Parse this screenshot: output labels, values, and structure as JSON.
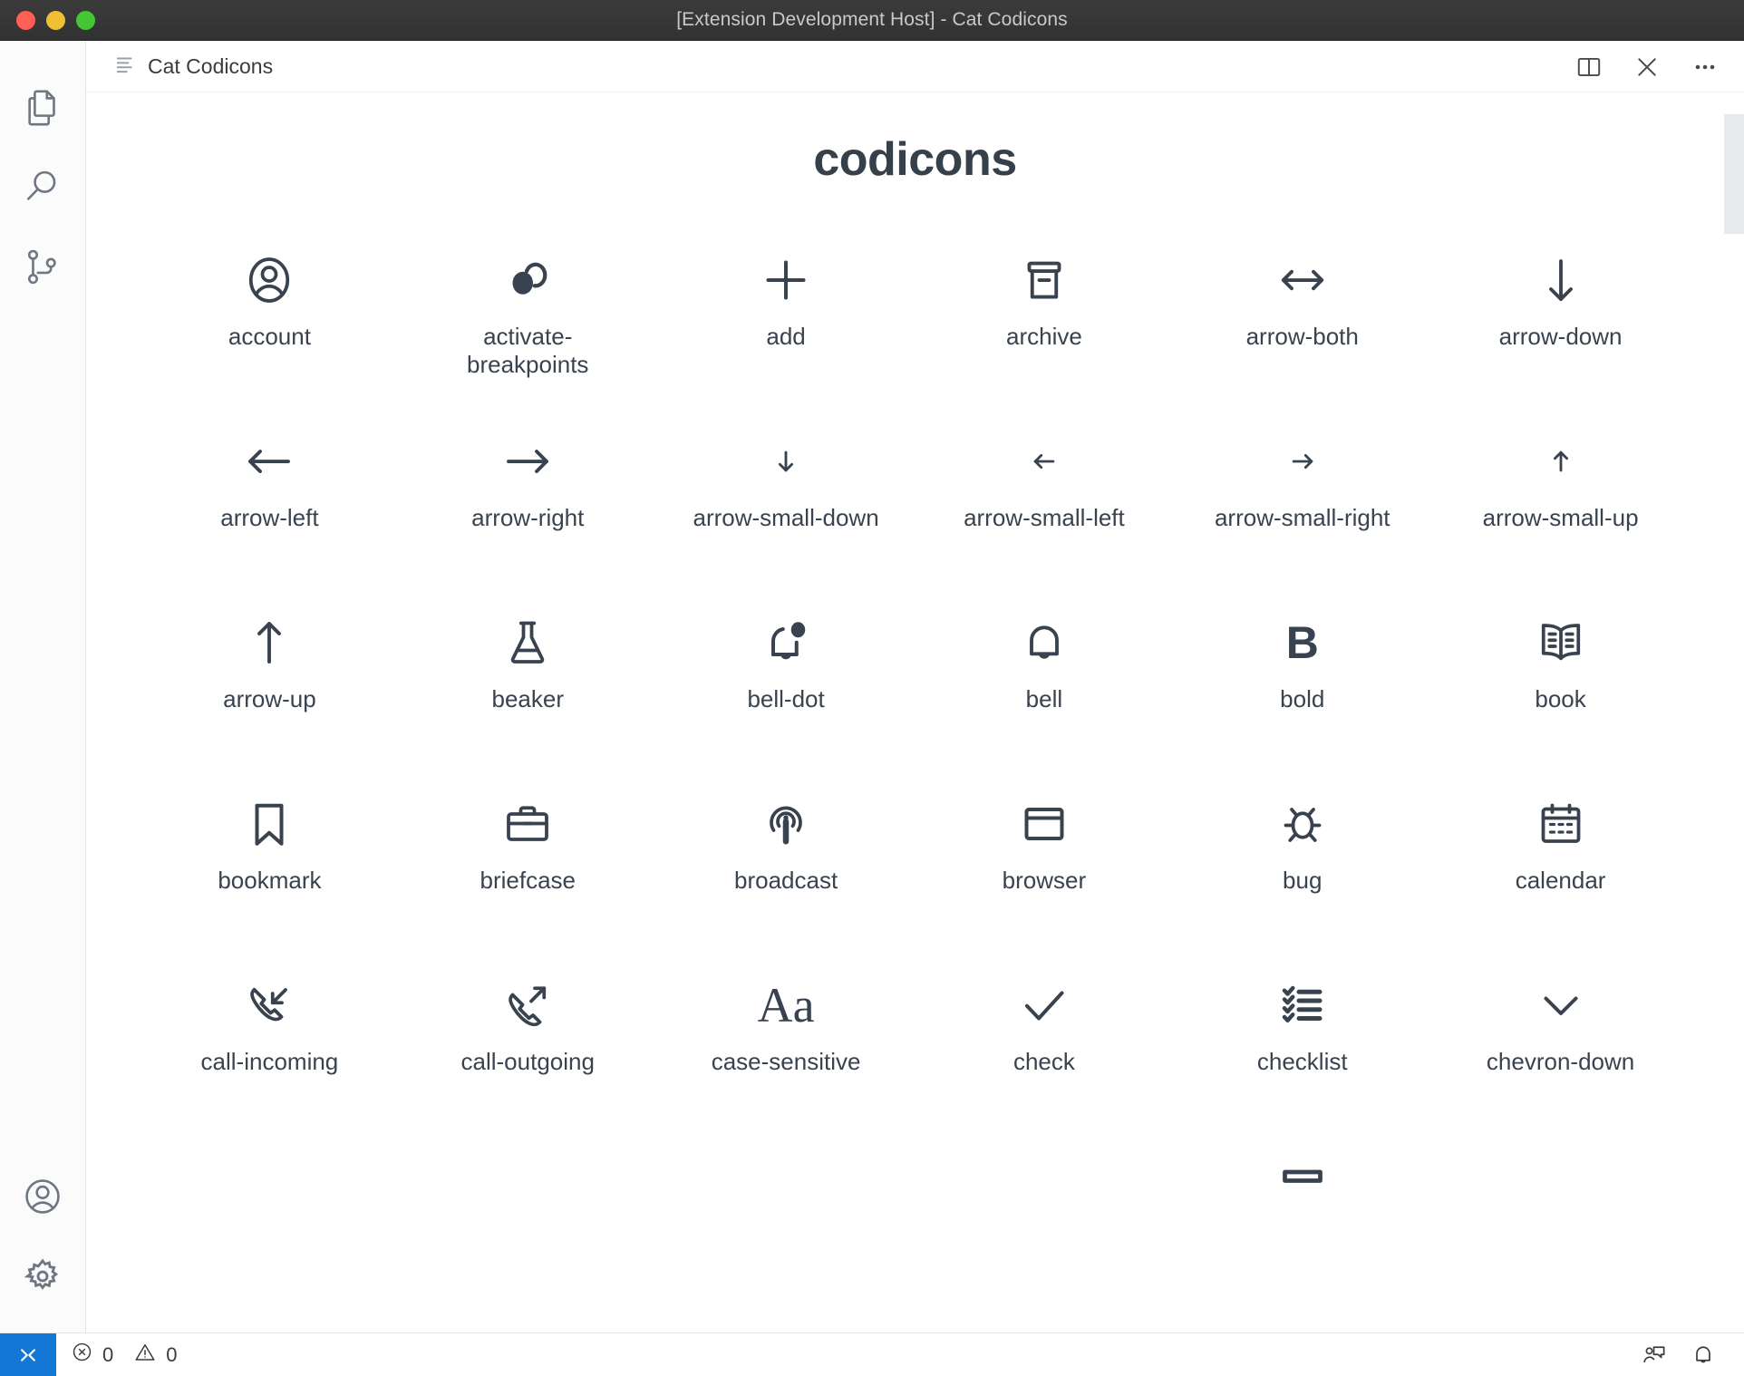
{
  "window": {
    "title": "[Extension Development Host] - Cat Codicons",
    "traffic_lights": [
      {
        "name": "close",
        "color": "#ff5f57"
      },
      {
        "name": "minimize",
        "color": "#f0bf33"
      },
      {
        "name": "zoom",
        "color": "#45c635"
      }
    ]
  },
  "activity_bar": {
    "top_items": [
      {
        "name": "explorer",
        "icon": "files-icon"
      },
      {
        "name": "search",
        "icon": "search-icon"
      },
      {
        "name": "source-control",
        "icon": "source-control-icon"
      }
    ],
    "bottom_items": [
      {
        "name": "accounts",
        "icon": "account-icon"
      },
      {
        "name": "manage",
        "icon": "gear-icon"
      }
    ]
  },
  "tab": {
    "label": "Cat Codicons",
    "icon": "preview-lines-icon",
    "actions": [
      {
        "name": "split-editor",
        "icon": "split-editor-icon"
      },
      {
        "name": "close-editor",
        "icon": "close-icon"
      },
      {
        "name": "more-actions",
        "icon": "ellipsis-icon"
      }
    ]
  },
  "page": {
    "title": "codicons",
    "icons": [
      {
        "label": "account",
        "glyph": "account"
      },
      {
        "label": "activate-breakpoints",
        "glyph": "activate-breakpoints"
      },
      {
        "label": "add",
        "glyph": "add"
      },
      {
        "label": "archive",
        "glyph": "archive"
      },
      {
        "label": "arrow-both",
        "glyph": "arrow-both"
      },
      {
        "label": "arrow-down",
        "glyph": "arrow-down"
      },
      {
        "label": "arrow-left",
        "glyph": "arrow-left"
      },
      {
        "label": "arrow-right",
        "glyph": "arrow-right"
      },
      {
        "label": "arrow-small-down",
        "glyph": "arrow-small-down"
      },
      {
        "label": "arrow-small-left",
        "glyph": "arrow-small-left"
      },
      {
        "label": "arrow-small-right",
        "glyph": "arrow-small-right"
      },
      {
        "label": "arrow-small-up",
        "glyph": "arrow-small-up"
      },
      {
        "label": "arrow-up",
        "glyph": "arrow-up"
      },
      {
        "label": "beaker",
        "glyph": "beaker"
      },
      {
        "label": "bell-dot",
        "glyph": "bell-dot"
      },
      {
        "label": "bell",
        "glyph": "bell"
      },
      {
        "label": "bold",
        "glyph": "bold"
      },
      {
        "label": "book",
        "glyph": "book"
      },
      {
        "label": "bookmark",
        "glyph": "bookmark"
      },
      {
        "label": "briefcase",
        "glyph": "briefcase"
      },
      {
        "label": "broadcast",
        "glyph": "broadcast"
      },
      {
        "label": "browser",
        "glyph": "browser"
      },
      {
        "label": "bug",
        "glyph": "bug"
      },
      {
        "label": "calendar",
        "glyph": "calendar"
      },
      {
        "label": "call-incoming",
        "glyph": "call-incoming"
      },
      {
        "label": "call-outgoing",
        "glyph": "call-outgoing"
      },
      {
        "label": "case-sensitive",
        "glyph": "case-sensitive"
      },
      {
        "label": "check",
        "glyph": "check"
      },
      {
        "label": "checklist",
        "glyph": "checklist"
      },
      {
        "label": "chevron-down",
        "glyph": "chevron-down"
      }
    ],
    "partial_row": [
      {
        "label": "",
        "glyph": "none"
      },
      {
        "label": "",
        "glyph": "none"
      },
      {
        "label": "",
        "glyph": "none"
      },
      {
        "label": "",
        "glyph": "none"
      },
      {
        "label": "",
        "glyph": "case-partial"
      },
      {
        "label": "",
        "glyph": "none"
      }
    ]
  },
  "status_bar": {
    "remote_label": "><",
    "errors": "0",
    "warnings": "0",
    "right_icons": [
      {
        "name": "feedback-icon"
      },
      {
        "name": "bell-icon"
      }
    ]
  },
  "colors": {
    "accent": "#1477d6",
    "icon_ink": "#39434f",
    "title_ink": "#36404a",
    "titlebar_bg": "#323232",
    "activitybar_bg": "#fbfbfb"
  }
}
